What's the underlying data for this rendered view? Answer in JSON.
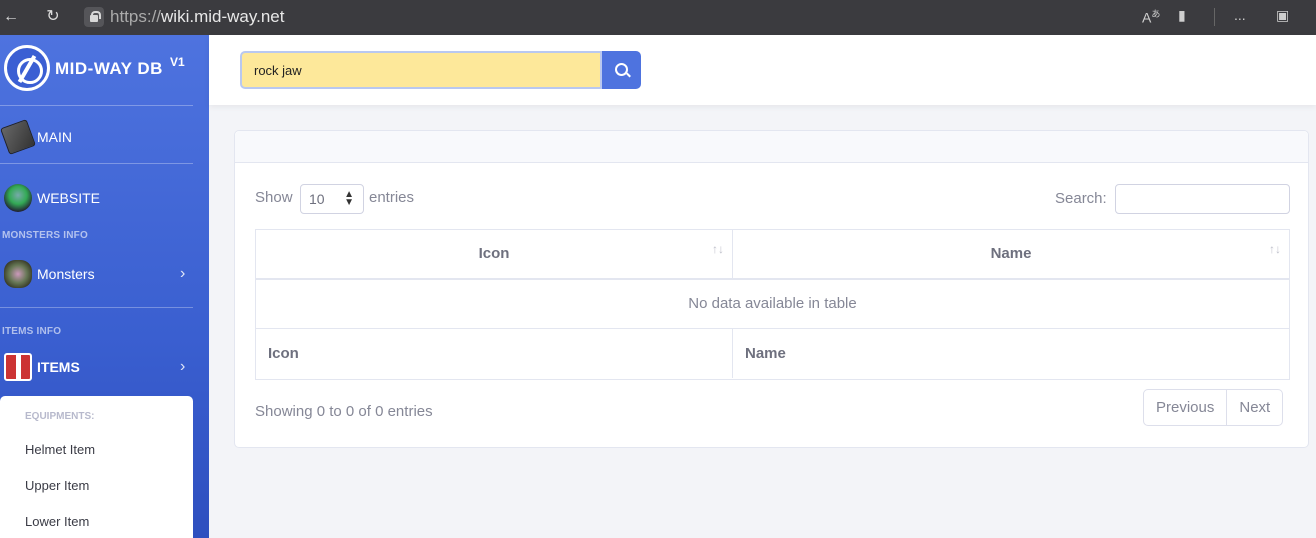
{
  "browser": {
    "url_protocol": "https://",
    "url_host": "wiki.mid-way.net",
    "menu_label": "..."
  },
  "sidebar": {
    "brand_name": "MID-WAY DB",
    "brand_version": "V1",
    "items": [
      {
        "label": "MAIN",
        "icon": "book-icon"
      },
      {
        "label": "WEBSITE",
        "icon": "monster-icon"
      },
      {
        "heading": "MONSTERS INFO"
      },
      {
        "label": "Monsters",
        "icon": "monster-icon",
        "chevron": true
      },
      {
        "heading": "ITEMS INFO"
      },
      {
        "label": "ITEMS",
        "icon": "gift-icon",
        "chevron": true
      }
    ],
    "submenu": {
      "heading": "EQUIPMENTS:",
      "items": [
        "Helmet Item",
        "Upper Item",
        "Lower Item"
      ]
    }
  },
  "topbar": {
    "search_value": "rock jaw"
  },
  "table": {
    "show_label": "Show",
    "entries_value": "10",
    "entries_label": "entries",
    "search_label": "Search:",
    "columns": [
      "Icon",
      "Name"
    ],
    "empty_message": "No data available in table",
    "footer_columns": [
      "Icon",
      "Name"
    ],
    "info": "Showing 0 to 0 of 0 entries",
    "prev_label": "Previous",
    "next_label": "Next"
  },
  "colors": {
    "primary": "#4e73df",
    "search_highlight": "#fde89a",
    "text_muted": "#858796"
  }
}
